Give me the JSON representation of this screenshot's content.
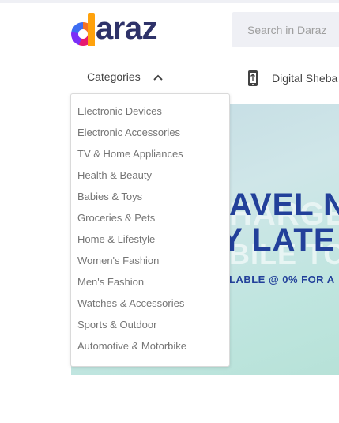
{
  "header": {
    "logo_text": "daraz",
    "search": {
      "placeholder": "Search in Daraz",
      "value": ""
    }
  },
  "nav": {
    "categories_label": "Categories",
    "digital_label": "Digital Sheba"
  },
  "categories_menu": {
    "items": [
      {
        "label": "Electronic Devices"
      },
      {
        "label": "Electronic Accessories"
      },
      {
        "label": "TV & Home Appliances"
      },
      {
        "label": "Health & Beauty"
      },
      {
        "label": "Babies & Toys"
      },
      {
        "label": "Groceries & Pets"
      },
      {
        "label": "Home & Lifestyle"
      },
      {
        "label": "Women's Fashion"
      },
      {
        "label": "Men's Fashion"
      },
      {
        "label": "Watches & Accessories"
      },
      {
        "label": "Sports & Outdoor"
      },
      {
        "label": "Automotive & Motorbike"
      }
    ]
  },
  "banner": {
    "line1": "AVEL N",
    "line2": "HARGE",
    "line3": "Y LATE",
    "line4": "BILE TOPU",
    "line5": "LABLE @ 0% FOR A"
  },
  "colors": {
    "brand_navy": "#2e3269",
    "search_bg": "#eff0f5",
    "banner_blue": "#22409a"
  },
  "icons": {
    "categories_toggle": "chevron-up-icon",
    "digital": "mobile-phone-icon"
  }
}
